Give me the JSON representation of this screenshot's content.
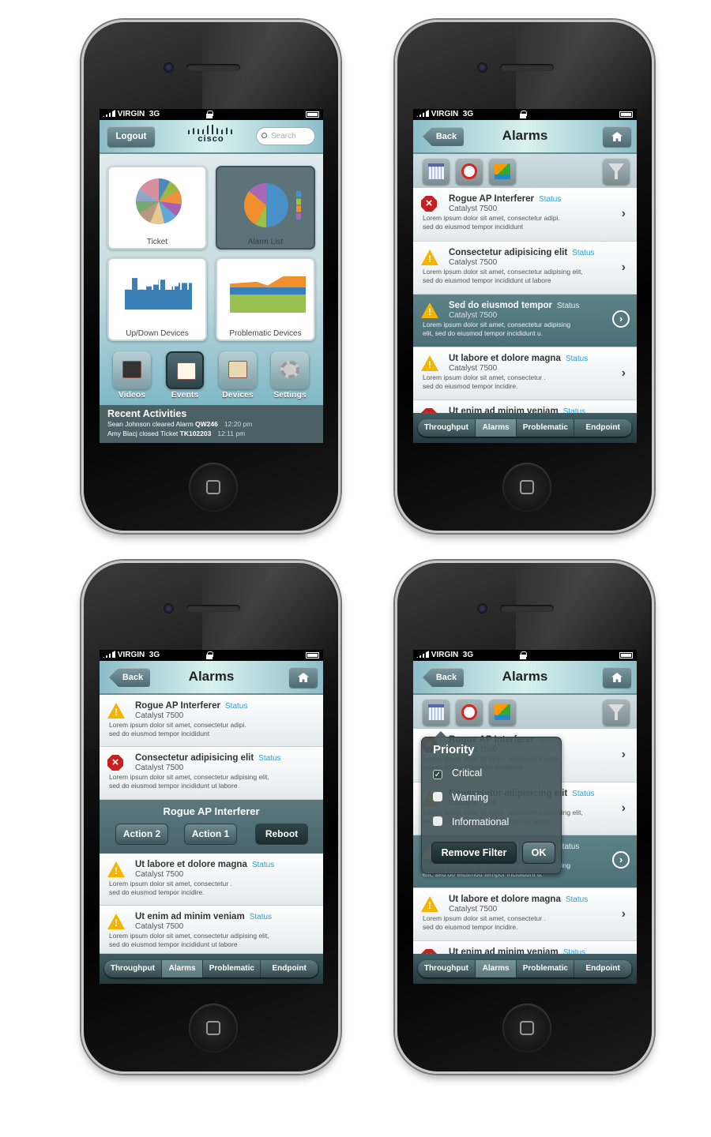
{
  "status_bar": {
    "carrier": "VIRGIN",
    "network": "3G"
  },
  "home": {
    "logout_label": "Logout",
    "logo_text": "cisco",
    "search_placeholder": "Search",
    "tiles": [
      {
        "label": "Ticket"
      },
      {
        "label": "Alarm List"
      },
      {
        "label": "Up/Down Devices"
      },
      {
        "label": "Problematic Devices"
      }
    ],
    "apps": [
      {
        "label": "Videos",
        "icon": "video-camera-icon"
      },
      {
        "label": "Events",
        "icon": "notebook-icon"
      },
      {
        "label": "Devices",
        "icon": "clipboard-icon"
      },
      {
        "label": "Settings",
        "icon": "gear-icon"
      }
    ],
    "recent": {
      "title": "Recent Activities",
      "items": [
        {
          "text": "Sean Johnson cleared Alarm ",
          "ref": "QW246",
          "time": "12:20 pm"
        },
        {
          "text": "Amy Blacj closed Ticket ",
          "ref": "TK102203",
          "time": "12:11 pm"
        }
      ]
    }
  },
  "alarms": {
    "title": "Alarms",
    "back_label": "Back",
    "toolbar_icons": [
      "calendar-icon",
      "alarm-clock-icon",
      "devices-icon",
      "filter-add-icon"
    ],
    "tabs": [
      {
        "label": "Throughput",
        "active": false
      },
      {
        "label": "Alarms",
        "active": true
      },
      {
        "label": "Problematic",
        "active": false
      },
      {
        "label": "Endpoint",
        "active": false
      }
    ],
    "list": [
      {
        "severity": "error",
        "title": "Rogue AP Interferer",
        "status": "Status",
        "device": "Catalyst 7500",
        "desc": [
          "Lorem ipsum dolor sit amet, consectetur adipi.",
          "sed do eiusmod tempor incididunt"
        ],
        "highlighted": false
      },
      {
        "severity": "warning",
        "title": "Consectetur adipisicing elit",
        "status": "Status",
        "device": "Catalyst 7500",
        "desc": [
          "Lorem ipsum dolor sit amet, consectetur adipising elit,",
          "sed do eiusmod tempor incididunt ut labore"
        ],
        "highlighted": false
      },
      {
        "severity": "warning",
        "title": "Sed do eiusmod tempor",
        "status": "Status",
        "device": "Catalyst 7500",
        "desc": [
          "Lorem ipsum dolor sit amet, consectetur adipising",
          "elit, sed do eiusmod tempor incididunt u."
        ],
        "highlighted": true
      },
      {
        "severity": "warning",
        "title": "Ut labore et dolore magna",
        "status": "Status",
        "device": "Catalyst 7500",
        "desc": [
          "Lorem ipsum dolor sit amet, consectetur .",
          "sed do eiusmod tempor incidire."
        ],
        "highlighted": false
      },
      {
        "severity": "error",
        "title": "Ut enim ad minim veniam",
        "status": "Status",
        "device": "",
        "desc": [],
        "highlighted": false
      }
    ],
    "action_list": [
      {
        "severity": "warning",
        "title": "Rogue AP Interferer",
        "status": "Status",
        "device": "Catalyst 7500",
        "desc": [
          "Lorem ipsum dolor sit amet, consectetur adipi.",
          "sed do eiusmod tempor incididunt"
        ]
      },
      {
        "severity": "error",
        "title": "Consectetur adipisicing elit",
        "status": "Status",
        "device": "Catalyst 7500",
        "desc": [
          "Lorem ipsum dolor sit amet, consectetur adipising elit,",
          "sed do eiusmod tempor incididunt ut labore"
        ]
      },
      {
        "severity": "warning",
        "title": "Ut labore et dolore magna",
        "status": "Status",
        "device": "Catalyst 7500",
        "desc": [
          "Lorem ipsum dolor sit amet, consectetur .",
          "sed do eiusmod tempor incidire."
        ]
      },
      {
        "severity": "warning",
        "title": "Ut enim ad minim veniam",
        "status": "Status",
        "device": "Catalyst 7500",
        "desc": [
          "Lorem ipsum dolor sit amet, consectetur adipising elit,",
          "sed do eiusmod tempor incididunt ut labore"
        ]
      }
    ],
    "action_panel": {
      "title": "Rogue AP Interferer",
      "buttons": [
        "Action 2",
        "Action 1",
        "Reboot"
      ]
    },
    "filter": {
      "title": "Priority",
      "options": [
        {
          "label": "Critical",
          "checked": true
        },
        {
          "label": "Warning",
          "checked": false
        },
        {
          "label": "Informational",
          "checked": false
        }
      ],
      "remove_label": "Remove Filter",
      "ok_label": "OK"
    }
  },
  "colors": {
    "accent_blue": "#2aa0dc",
    "header_teal": "#8cbdc8",
    "highlight_row": "#4f757b",
    "error_red": "#c62020",
    "warning_yellow": "#f4b400"
  }
}
